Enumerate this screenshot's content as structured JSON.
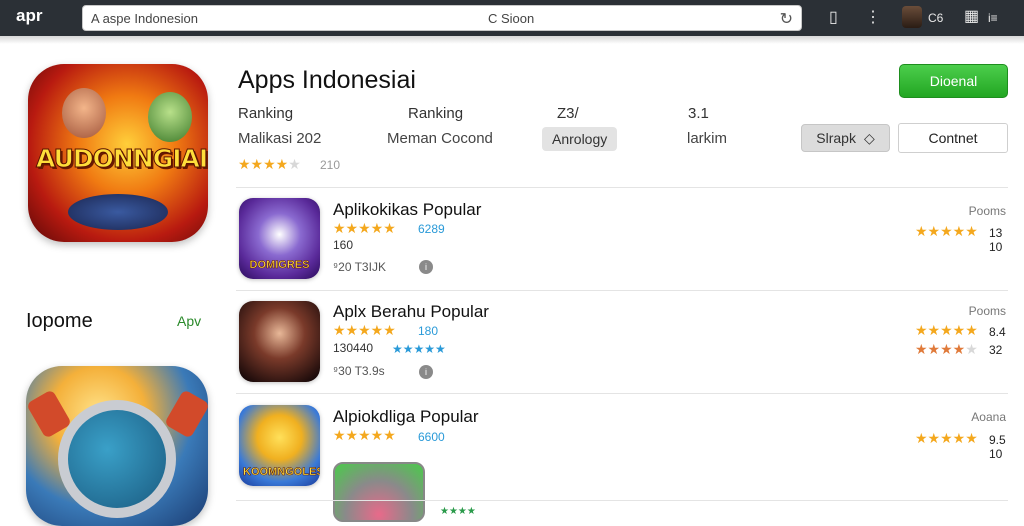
{
  "topbar": {
    "brand": "apr",
    "url": "A aspe Indonesion",
    "url_center": "C Sioon",
    "right_label_1": "C6",
    "right_label_2": "i≡"
  },
  "app": {
    "title": "Apps Indonesiai",
    "download_label": "Dioenal",
    "meta_col1_label": "Ranking",
    "meta_col1_value": "Malikasi 202",
    "meta_col2_label": "Ranking",
    "meta_col2_value": "Meman Cocond",
    "meta_col3_label": "Z3/",
    "meta_col3_chip": "Anrology",
    "meta_col4_label": "3.1",
    "meta_col4_value": "larkim",
    "select_label": "Slrapk",
    "content_button": "Contnet",
    "rating_count": "210",
    "hero_icon_text": "AUDONNGIAI",
    "rating_stars": 4.5
  },
  "sidebar": {
    "heading": "Iopome",
    "link": "Apv"
  },
  "list": [
    {
      "title": "Aplikokikas Popular",
      "score": "6289",
      "count": "160",
      "meta": "⁹20 T3IJK",
      "right_label": "Pooms",
      "right_num_1": "13",
      "right_num_2": "10",
      "thumb_text": "DOMIGRES"
    },
    {
      "title": "Aplx Berahu Popular",
      "score": "180",
      "count": "130440",
      "meta": "⁹30 T3.9s",
      "right_label": "Pooms",
      "right_num_1": "8.4",
      "right_num_2": "32",
      "thumb_text": ""
    },
    {
      "title": "Alpiokdliga Popular",
      "score": "6600",
      "count": "",
      "meta": "",
      "right_label": "Aoana",
      "right_num_1": "9.5",
      "right_num_2": "10",
      "thumb_text": "KOOMNGOLES"
    }
  ],
  "colors": {
    "accent_green": "#22a622",
    "star": "#f4a81e",
    "link_blue": "#2a9ad8",
    "topbar": "#2b3036"
  }
}
